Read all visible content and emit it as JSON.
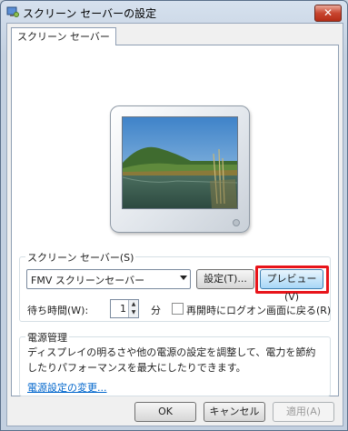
{
  "window": {
    "title": "スクリーン セーバーの設定",
    "close_label": "✕"
  },
  "tab": {
    "label": "スクリーン セーバー"
  },
  "screensaver_group": {
    "label": "スクリーン セーバー(S)",
    "selected": "FMV スクリーンセーバー",
    "settings_button": "設定(T)...",
    "preview_button": "プレビュー(V)",
    "wait_label": "待ち時間(W):",
    "wait_value": "1",
    "minutes_label": "分",
    "resume_label": "再開時にログオン画面に戻る(R)",
    "resume_checked": false
  },
  "power_group": {
    "label": "電源管理",
    "description": "ディスプレイの明るさや他の電源の設定を調整して、電力を節約したりパフォーマンスを最大にしたりできます。",
    "link": "電源設定の変更..."
  },
  "buttons": {
    "ok": "OK",
    "cancel": "キャンセル",
    "apply": "適用(A)"
  },
  "colors": {
    "highlight": "#e8141a",
    "link": "#0066cc"
  }
}
